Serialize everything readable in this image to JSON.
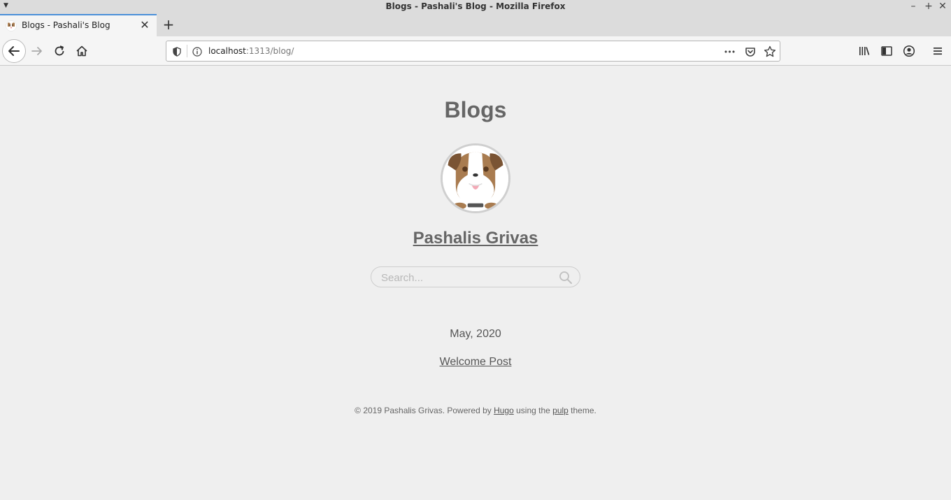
{
  "window": {
    "title": "Blogs - Pashali's Blog - Mozilla Firefox"
  },
  "tab": {
    "label": "Blogs - Pashali's Blog",
    "close_glyph": "✕"
  },
  "newtab_glyph": "+",
  "urlbar": {
    "host": "localhost",
    "path": ":1313/blog/",
    "more_glyph": "•••"
  },
  "page": {
    "heading": "Blogs",
    "author": "Pashalis Grivas",
    "search_placeholder": "Search...",
    "month": "May, 2020",
    "post": "Welcome Post",
    "footer": {
      "prefix": "© 2019 Pashalis Grivas. Powered by ",
      "hugo": "Hugo",
      "middle": " using the ",
      "pulp": "pulp",
      "suffix": " theme."
    }
  },
  "colors": {
    "accent": "#4a90d9",
    "page_bg": "#efefef",
    "heading": "#666666"
  },
  "icons": [
    "dropdown-icon",
    "minimize-icon",
    "maximize-icon",
    "close-window-icon",
    "favicon-icon",
    "back-icon",
    "forward-icon",
    "reload-icon",
    "home-icon",
    "shield-icon",
    "info-icon",
    "more-icon",
    "pocket-icon",
    "bookmark-star-icon",
    "library-icon",
    "sidebar-icon",
    "account-icon",
    "menu-icon",
    "search-icon"
  ]
}
